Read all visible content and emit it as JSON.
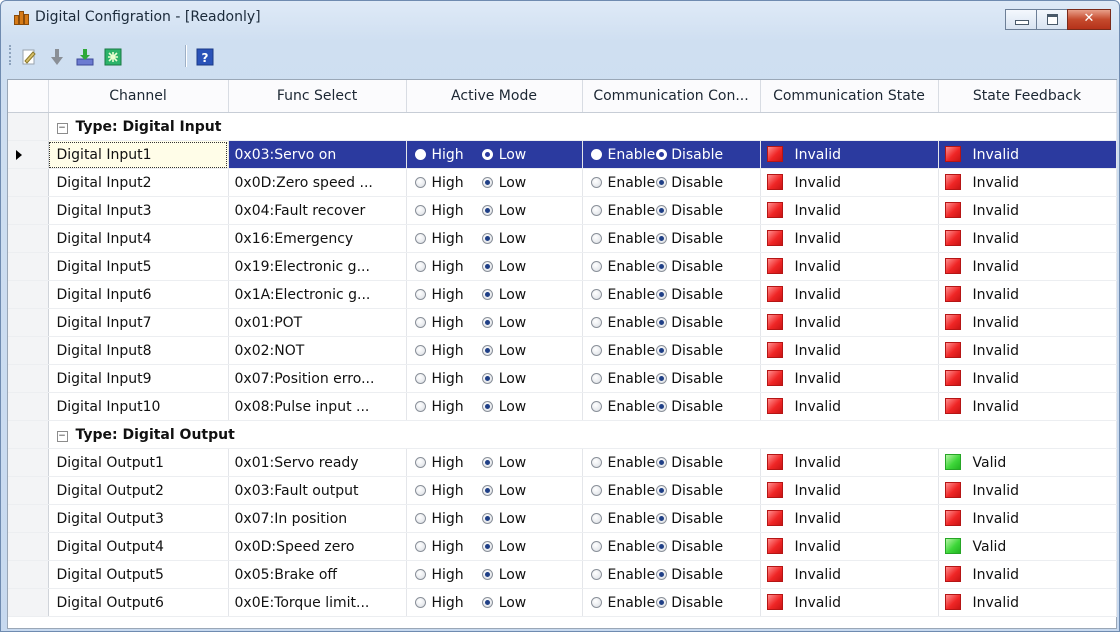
{
  "window": {
    "title": "Digital Configration - [Readonly]",
    "buttons": [
      "minimize",
      "maximize",
      "close"
    ],
    "close_glyph": "✕"
  },
  "toolbar": {
    "icons": [
      "edit-icon",
      "download-arrow-icon",
      "import-icon",
      "refresh-icon",
      "help-icon"
    ],
    "help_glyph": "?"
  },
  "grid": {
    "columns": [
      "Channel",
      "Func Select",
      "Active Mode",
      "Communication Con...",
      "Communication State",
      "State Feedback"
    ],
    "radio_labels": {
      "high": "High",
      "low": "Low",
      "enable": "Enable",
      "disable": "Disable"
    },
    "groups": [
      {
        "title": "Type: Digital Input",
        "expander": "−",
        "rows": [
          {
            "channel": "Digital Input1",
            "func": "0x03:Servo on",
            "active_mode": "Low",
            "comm_control": "Disable",
            "comm_state": "Invalid",
            "state_feedback": "Invalid",
            "selected": true
          },
          {
            "channel": "Digital Input2",
            "func": "0x0D:Zero speed ...",
            "active_mode": "Low",
            "comm_control": "Disable",
            "comm_state": "Invalid",
            "state_feedback": "Invalid"
          },
          {
            "channel": "Digital Input3",
            "func": "0x04:Fault recover",
            "active_mode": "Low",
            "comm_control": "Disable",
            "comm_state": "Invalid",
            "state_feedback": "Invalid"
          },
          {
            "channel": "Digital Input4",
            "func": "0x16:Emergency",
            "active_mode": "Low",
            "comm_control": "Disable",
            "comm_state": "Invalid",
            "state_feedback": "Invalid"
          },
          {
            "channel": "Digital Input5",
            "func": "0x19:Electronic g...",
            "active_mode": "Low",
            "comm_control": "Disable",
            "comm_state": "Invalid",
            "state_feedback": "Invalid"
          },
          {
            "channel": "Digital Input6",
            "func": "0x1A:Electronic g...",
            "active_mode": "Low",
            "comm_control": "Disable",
            "comm_state": "Invalid",
            "state_feedback": "Invalid"
          },
          {
            "channel": "Digital Input7",
            "func": "0x01:POT",
            "active_mode": "Low",
            "comm_control": "Disable",
            "comm_state": "Invalid",
            "state_feedback": "Invalid"
          },
          {
            "channel": "Digital Input8",
            "func": "0x02:NOT",
            "active_mode": "Low",
            "comm_control": "Disable",
            "comm_state": "Invalid",
            "state_feedback": "Invalid"
          },
          {
            "channel": "Digital Input9",
            "func": "0x07:Position erro...",
            "active_mode": "Low",
            "comm_control": "Disable",
            "comm_state": "Invalid",
            "state_feedback": "Invalid"
          },
          {
            "channel": "Digital Input10",
            "func": "0x08:Pulse input ...",
            "active_mode": "Low",
            "comm_control": "Disable",
            "comm_state": "Invalid",
            "state_feedback": "Invalid"
          }
        ]
      },
      {
        "title": "Type: Digital Output",
        "expander": "−",
        "rows": [
          {
            "channel": "Digital Output1",
            "func": "0x01:Servo ready",
            "active_mode": "Low",
            "comm_control": "Disable",
            "comm_state": "Invalid",
            "state_feedback": "Valid"
          },
          {
            "channel": "Digital Output2",
            "func": "0x03:Fault output",
            "active_mode": "Low",
            "comm_control": "Disable",
            "comm_state": "Invalid",
            "state_feedback": "Invalid"
          },
          {
            "channel": "Digital Output3",
            "func": "0x07:In position",
            "active_mode": "Low",
            "comm_control": "Disable",
            "comm_state": "Invalid",
            "state_feedback": "Invalid"
          },
          {
            "channel": "Digital Output4",
            "func": "0x0D:Speed zero",
            "active_mode": "Low",
            "comm_control": "Disable",
            "comm_state": "Invalid",
            "state_feedback": "Valid"
          },
          {
            "channel": "Digital Output5",
            "func": "0x05:Brake off",
            "active_mode": "Low",
            "comm_control": "Disable",
            "comm_state": "Invalid",
            "state_feedback": "Invalid"
          },
          {
            "channel": "Digital Output6",
            "func": "0x0E:Torque limit...",
            "active_mode": "Low",
            "comm_control": "Disable",
            "comm_state": "Invalid",
            "state_feedback": "Invalid"
          }
        ]
      }
    ]
  },
  "colors": {
    "selected_row": "#2b3a9f",
    "invalid": "#f02626",
    "valid": "#3fd73a"
  }
}
